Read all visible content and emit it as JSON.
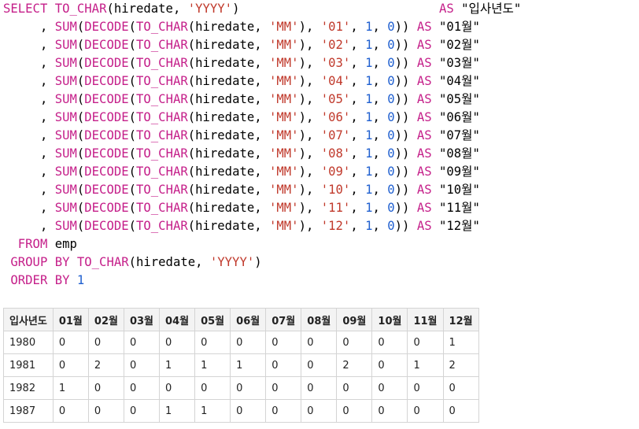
{
  "query": {
    "select_kw": "SELECT",
    "first_line": {
      "fn": "TO_CHAR",
      "open": "(hiredate, ",
      "fmt": "'YYYY'",
      "close": ")",
      "as_kw": "AS",
      "alias": "\"입사년도\""
    },
    "month_lines": [
      {
        "lead": "     , ",
        "sum": "SUM",
        "decode": "DECODE",
        "to_char": "TO_CHAR",
        "arg": "hiredate",
        "mm": "'MM'",
        "month": "'01'",
        "one": "1",
        "zero": "0",
        "as_kw": "AS",
        "alias": "\"01월\""
      },
      {
        "lead": "     , ",
        "sum": "SUM",
        "decode": "DECODE",
        "to_char": "TO_CHAR",
        "arg": "hiredate",
        "mm": "'MM'",
        "month": "'02'",
        "one": "1",
        "zero": "0",
        "as_kw": "AS",
        "alias": "\"02월\""
      },
      {
        "lead": "     , ",
        "sum": "SUM",
        "decode": "DECODE",
        "to_char": "TO_CHAR",
        "arg": "hiredate",
        "mm": "'MM'",
        "month": "'03'",
        "one": "1",
        "zero": "0",
        "as_kw": "AS",
        "alias": "\"03월\""
      },
      {
        "lead": "     , ",
        "sum": "SUM",
        "decode": "DECODE",
        "to_char": "TO_CHAR",
        "arg": "hiredate",
        "mm": "'MM'",
        "month": "'04'",
        "one": "1",
        "zero": "0",
        "as_kw": "AS",
        "alias": "\"04월\""
      },
      {
        "lead": "     , ",
        "sum": "SUM",
        "decode": "DECODE",
        "to_char": "TO_CHAR",
        "arg": "hiredate",
        "mm": "'MM'",
        "month": "'05'",
        "one": "1",
        "zero": "0",
        "as_kw": "AS",
        "alias": "\"05월\""
      },
      {
        "lead": "     , ",
        "sum": "SUM",
        "decode": "DECODE",
        "to_char": "TO_CHAR",
        "arg": "hiredate",
        "mm": "'MM'",
        "month": "'06'",
        "one": "1",
        "zero": "0",
        "as_kw": "AS",
        "alias": "\"06월\""
      },
      {
        "lead": "     , ",
        "sum": "SUM",
        "decode": "DECODE",
        "to_char": "TO_CHAR",
        "arg": "hiredate",
        "mm": "'MM'",
        "month": "'07'",
        "one": "1",
        "zero": "0",
        "as_kw": "AS",
        "alias": "\"07월\""
      },
      {
        "lead": "     , ",
        "sum": "SUM",
        "decode": "DECODE",
        "to_char": "TO_CHAR",
        "arg": "hiredate",
        "mm": "'MM'",
        "month": "'08'",
        "one": "1",
        "zero": "0",
        "as_kw": "AS",
        "alias": "\"08월\""
      },
      {
        "lead": "     , ",
        "sum": "SUM",
        "decode": "DECODE",
        "to_char": "TO_CHAR",
        "arg": "hiredate",
        "mm": "'MM'",
        "month": "'09'",
        "one": "1",
        "zero": "0",
        "as_kw": "AS",
        "alias": "\"09월\""
      },
      {
        "lead": "     , ",
        "sum": "SUM",
        "decode": "DECODE",
        "to_char": "TO_CHAR",
        "arg": "hiredate",
        "mm": "'MM'",
        "month": "'10'",
        "one": "1",
        "zero": "0",
        "as_kw": "AS",
        "alias": "\"10월\""
      },
      {
        "lead": "     , ",
        "sum": "SUM",
        "decode": "DECODE",
        "to_char": "TO_CHAR",
        "arg": "hiredate",
        "mm": "'MM'",
        "month": "'11'",
        "one": "1",
        "zero": "0",
        "as_kw": "AS",
        "alias": "\"11월\""
      },
      {
        "lead": "     , ",
        "sum": "SUM",
        "decode": "DECODE",
        "to_char": "TO_CHAR",
        "arg": "hiredate",
        "mm": "'MM'",
        "month": "'12'",
        "one": "1",
        "zero": "0",
        "as_kw": "AS",
        "alias": "\"12월\""
      }
    ],
    "from_kw": "FROM",
    "table": "emp",
    "group_kw": "GROUP BY",
    "group_fn": "TO_CHAR",
    "group_arg": "(hiredate, ",
    "group_fmt": "'YYYY'",
    "group_close": ")",
    "order_kw": "ORDER BY",
    "order_val": "1"
  },
  "result": {
    "headers": [
      "입사년도",
      "01월",
      "02월",
      "03월",
      "04월",
      "05월",
      "06월",
      "07월",
      "08월",
      "09월",
      "10월",
      "11월",
      "12월"
    ],
    "rows": [
      [
        "1980",
        "0",
        "0",
        "0",
        "0",
        "0",
        "0",
        "0",
        "0",
        "0",
        "0",
        "0",
        "1"
      ],
      [
        "1981",
        "0",
        "2",
        "0",
        "1",
        "1",
        "1",
        "0",
        "0",
        "2",
        "0",
        "1",
        "2"
      ],
      [
        "1982",
        "1",
        "0",
        "0",
        "0",
        "0",
        "0",
        "0",
        "0",
        "0",
        "0",
        "0",
        "0"
      ],
      [
        "1987",
        "0",
        "0",
        "0",
        "1",
        "1",
        "0",
        "0",
        "0",
        "0",
        "0",
        "0",
        "0"
      ]
    ]
  },
  "colors": {
    "keyword": "#c5208a",
    "string": "#c0392b",
    "number": "#2060d0",
    "header_bg": "#f3f3f3",
    "border": "#d4d4d4"
  }
}
